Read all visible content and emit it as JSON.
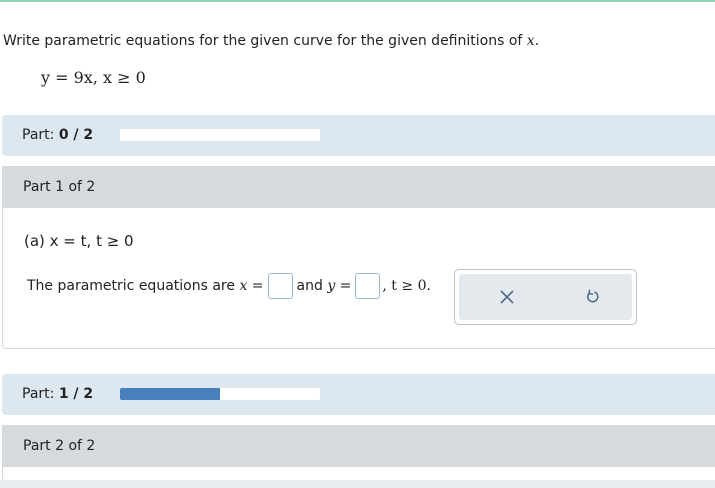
{
  "question": {
    "prompt_text": "Write parametric equations for the given curve for the given definitions of",
    "prompt_var": "x",
    "prompt_end": ".",
    "given_equation": "y = 9x, x ≥ 0"
  },
  "parts": [
    {
      "progress_label": "Part:",
      "progress_value": "0 / 2",
      "progress_fraction": 0.0,
      "header": "Part 1 of 2",
      "subquestion": "(a) x = t, t ≥ 0",
      "answer_line": {
        "prefix": "The parametric equations are",
        "x_label": "x =",
        "and_text": "and",
        "y_label": "y =",
        "suffix": ", t ≥ 0.",
        "x_value": "",
        "y_value": ""
      },
      "actions": {
        "clear_icon": "x-icon",
        "undo_icon": "undo-icon"
      }
    },
    {
      "progress_label": "Part:",
      "progress_value": "1 / 2",
      "progress_fraction": 0.5,
      "header": "Part 2 of 2"
    }
  ],
  "colors": {
    "progress_fill": "#4a7fbd",
    "part_bar_bg": "#dde7f0",
    "part_header_bg": "#d6dadd",
    "top_accent": "#8fd3b4"
  }
}
